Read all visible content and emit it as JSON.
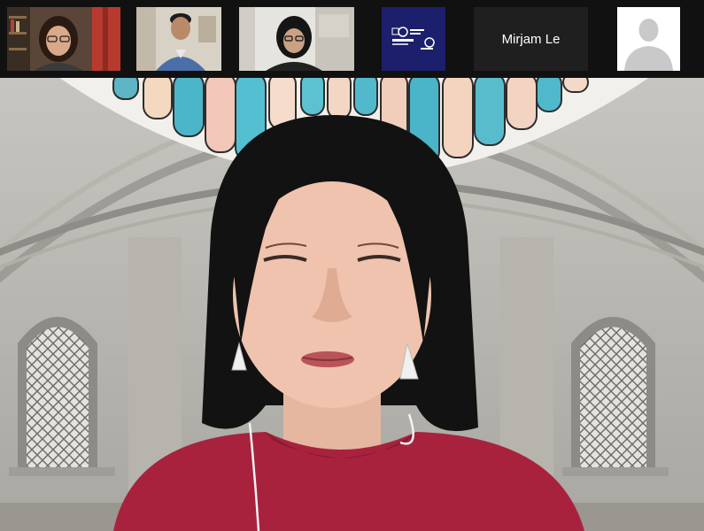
{
  "meeting": {
    "gallery": [
      {
        "kind": "video",
        "avatar": "participant-1-video"
      },
      {
        "kind": "video",
        "avatar": "participant-2-video"
      },
      {
        "kind": "video",
        "avatar": "participant-3-video"
      },
      {
        "kind": "video",
        "avatar": "university-logo-video"
      },
      {
        "kind": "name",
        "name": "Mirjam Le"
      },
      {
        "kind": "placeholder",
        "icon": "user-silhouette-icon"
      }
    ],
    "active_speaker": {
      "kind": "video",
      "background": "domed-hall-virtual-background"
    }
  },
  "colors": {
    "strip_bg": "#111111",
    "tile_bg": "#1f1f1f",
    "name_text": "#ffffff",
    "logo_bg": "#1c1f6b"
  }
}
